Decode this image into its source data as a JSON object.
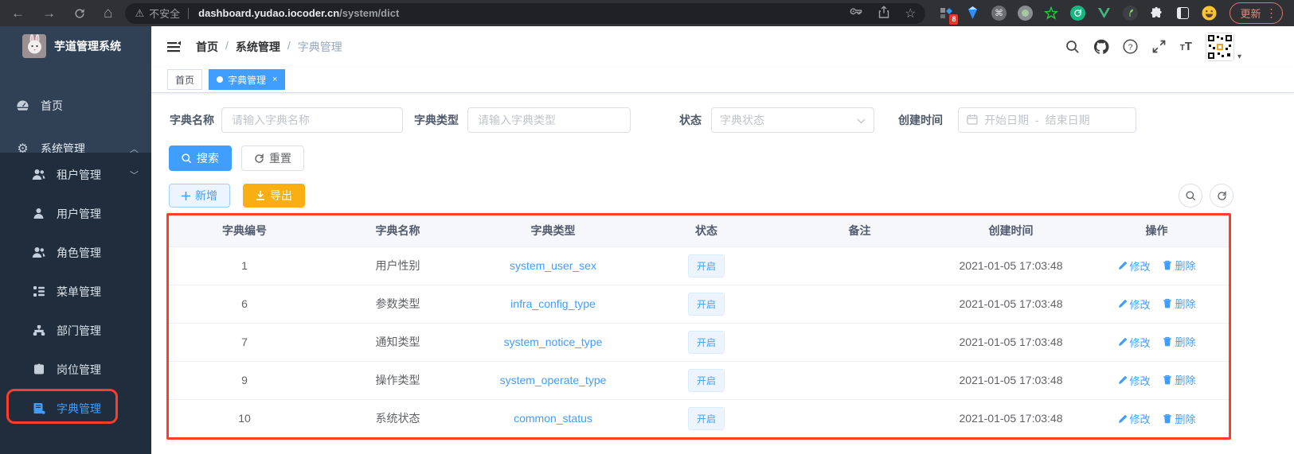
{
  "colors": {
    "accent": "#409eff",
    "warning": "#f9ae13",
    "annotation_red": "#fc3d2c",
    "sidebar_bg": "#304156",
    "submenu_bg": "#1f2d3d"
  },
  "glyphs": {
    "back": "←",
    "forward": "→",
    "home": "⌂",
    "warning": "⚠",
    "star": "☆",
    "command": "⌘",
    "kebab": "⋮",
    "caret_down": "▾",
    "gear": "⚙",
    "chevron_up": "︿",
    "chevron_down": "﹀",
    "close": "×"
  },
  "browser": {
    "security_label": "不安全",
    "url_domain": "dashboard.yudao.iocoder.cn",
    "url_path": "/system/dict",
    "extension_badge": "8",
    "update_label": "更新"
  },
  "sidebar": {
    "app_title": "芋道管理系统",
    "items": [
      {
        "label": "首页"
      },
      {
        "label": "系统管理"
      }
    ],
    "submenu": [
      {
        "label": "租户管理"
      },
      {
        "label": "用户管理"
      },
      {
        "label": "角色管理"
      },
      {
        "label": "菜单管理"
      },
      {
        "label": "部门管理"
      },
      {
        "label": "岗位管理"
      },
      {
        "label": "字典管理"
      }
    ]
  },
  "header": {
    "breadcrumb": [
      "首页",
      "系统管理",
      "字典管理"
    ],
    "breadcrumb_separator": "/"
  },
  "tags": {
    "home": "首页",
    "active": "字典管理"
  },
  "filters": {
    "name_label": "字典名称",
    "name_placeholder": "请输入字典名称",
    "type_label": "字典类型",
    "type_placeholder": "请输入字典类型",
    "status_label": "状态",
    "status_placeholder": "字典状态",
    "time_label": "创建时间",
    "start_placeholder": "开始日期",
    "range_separator": "-",
    "end_placeholder": "结束日期",
    "search_button": "搜索",
    "reset_button": "重置"
  },
  "toolbar": {
    "add_button": "新增",
    "export_button": "导出"
  },
  "table": {
    "columns": [
      "字典编号",
      "字典名称",
      "字典类型",
      "状态",
      "备注",
      "创建时间",
      "操作"
    ],
    "actions": {
      "edit": "修改",
      "delete": "删除"
    },
    "rows": [
      {
        "id": "1",
        "name": "用户性别",
        "type": "system_user_sex",
        "status": "开启",
        "remark": "",
        "created": "2021-01-05 17:03:48"
      },
      {
        "id": "6",
        "name": "参数类型",
        "type": "infra_config_type",
        "status": "开启",
        "remark": "",
        "created": "2021-01-05 17:03:48"
      },
      {
        "id": "7",
        "name": "通知类型",
        "type": "system_notice_type",
        "status": "开启",
        "remark": "",
        "created": "2021-01-05 17:03:48"
      },
      {
        "id": "9",
        "name": "操作类型",
        "type": "system_operate_type",
        "status": "开启",
        "remark": "",
        "created": "2021-01-05 17:03:48"
      },
      {
        "id": "10",
        "name": "系统状态",
        "type": "common_status",
        "status": "开启",
        "remark": "",
        "created": "2021-01-05 17:03:48"
      }
    ]
  }
}
